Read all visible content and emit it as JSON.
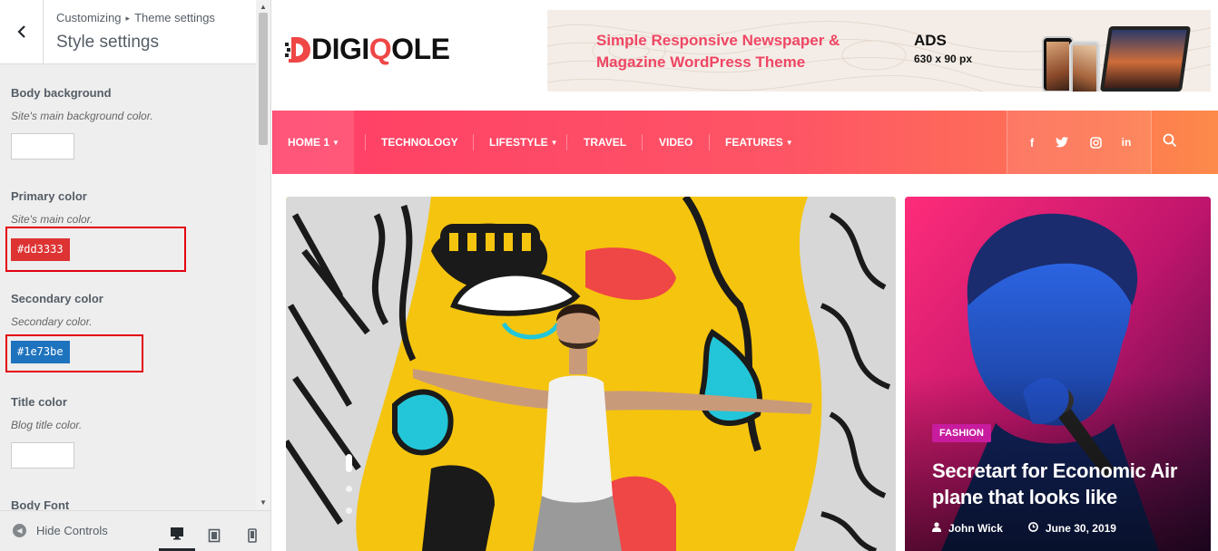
{
  "customizer": {
    "breadcrumb_root": "Customizing",
    "breadcrumb_sep": "▸",
    "breadcrumb_section": "Theme settings",
    "panel_title": "Style settings",
    "controls": [
      {
        "title": "Body background",
        "desc": "Site's main background color."
      },
      {
        "title": "Primary color",
        "desc": "Site's main color.",
        "value": "#dd3333",
        "color": "#dd3333"
      },
      {
        "title": "Secondary color",
        "desc": "Secondary color.",
        "value": "#1e73be",
        "color": "#1e73be"
      },
      {
        "title": "Title color",
        "desc": "Blog title color."
      },
      {
        "title": "Body Font"
      }
    ],
    "footer": {
      "hide_label": "Hide Controls"
    }
  },
  "site": {
    "logo_left": "DIGI",
    "logo_q": "Q",
    "logo_right": "OLE",
    "ad": {
      "headline": "Simple Responsive Newspaper & Magazine WordPress Theme",
      "label": "ADS",
      "size": "630 x 90 px"
    },
    "nav": [
      "HOME 1",
      "TECHNOLOGY",
      "LIFESTYLE",
      "TRAVEL",
      "VIDEO",
      "FEATURES"
    ],
    "featured": {
      "category": "FASHION",
      "title": "Secretart for Economic Air plane that looks like",
      "author": "John Wick",
      "date": "June 30, 2019"
    }
  },
  "colors": {
    "nav_start": "#ff3e67",
    "nav_end": "#fd8a4a",
    "accent": "#ef4646",
    "highlight": "#e3000f"
  }
}
